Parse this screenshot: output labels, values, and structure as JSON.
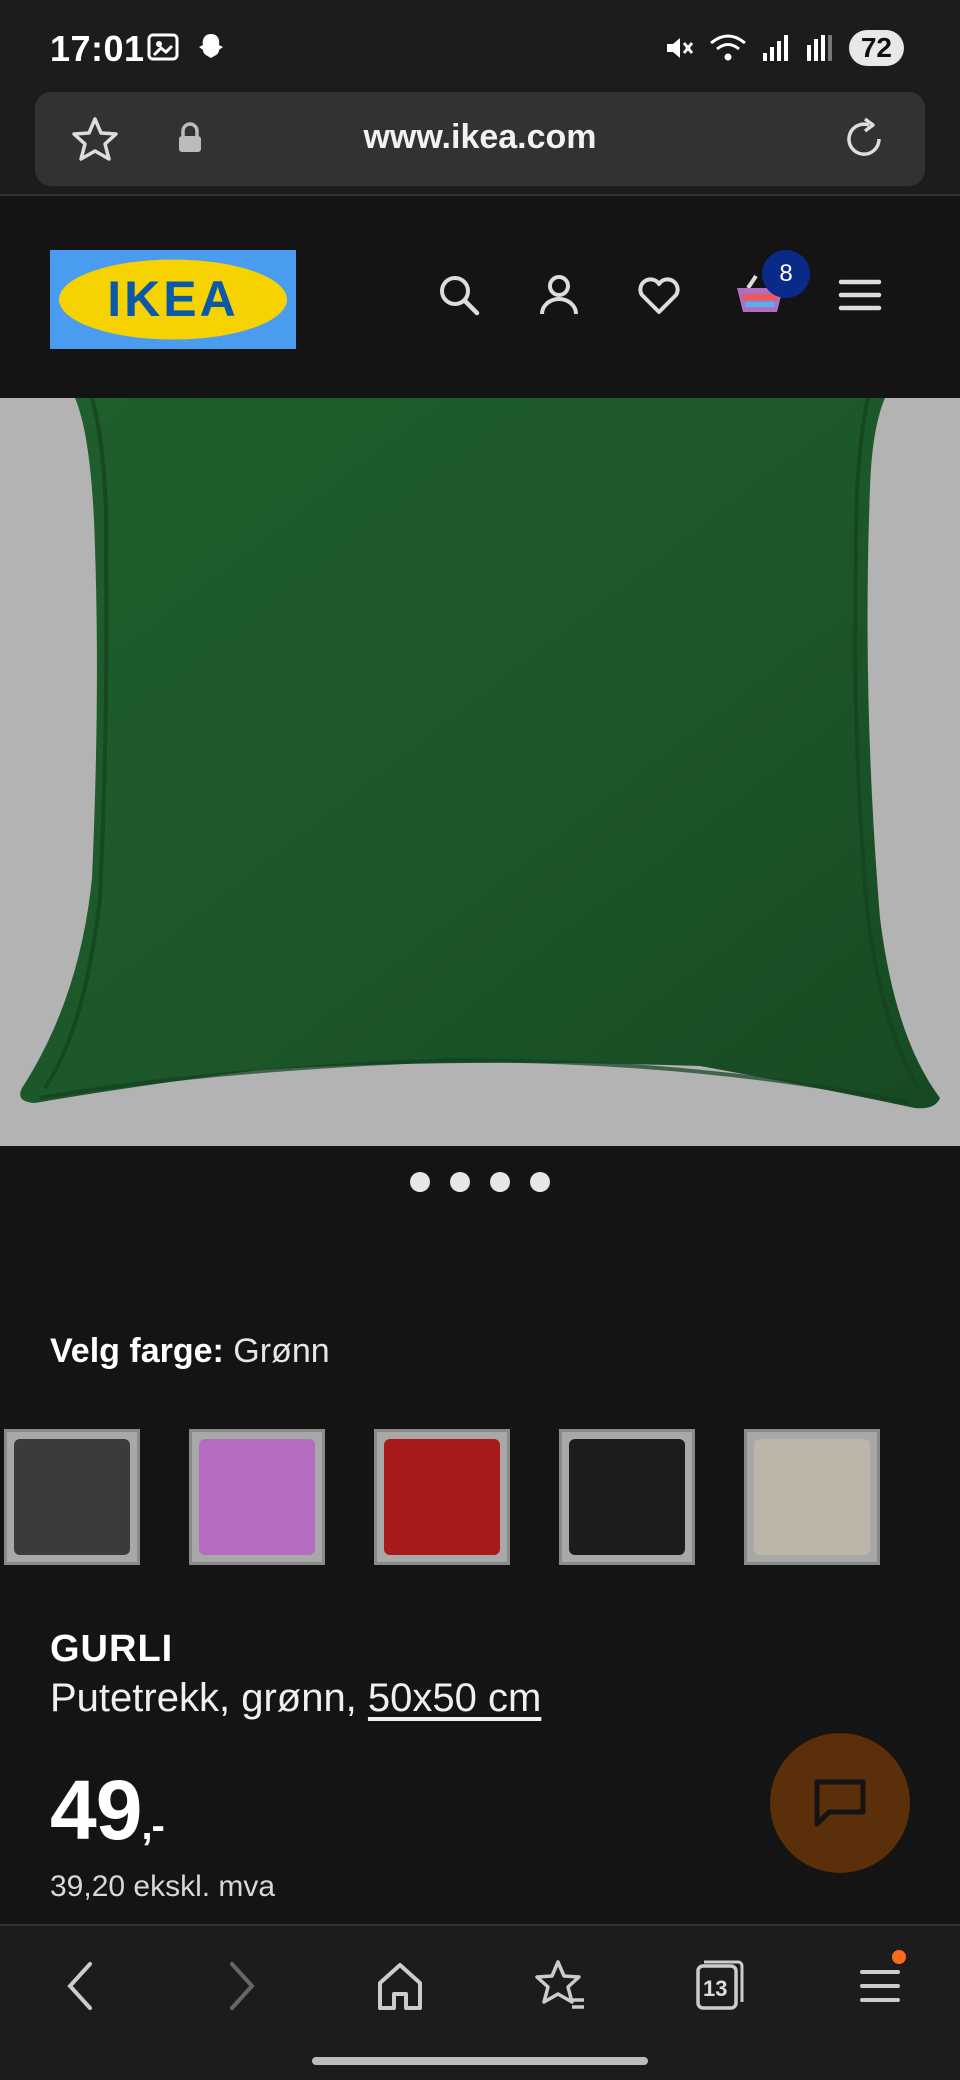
{
  "status_bar": {
    "time": "17:01",
    "battery": "72"
  },
  "browser": {
    "url": "www.ikea.com"
  },
  "header": {
    "logo_text": "IKEA",
    "cart_count": "8"
  },
  "gallery": {
    "dot_count": 4
  },
  "color_selector": {
    "label": "Velg farge:",
    "selected": "Grønn",
    "swatches": [
      {
        "name": "dark-grey",
        "color": "#3b3b3b"
      },
      {
        "name": "lilac",
        "color": "#b46cc0"
      },
      {
        "name": "red",
        "color": "#a81a1a"
      },
      {
        "name": "black",
        "color": "#1c1c1c"
      },
      {
        "name": "beige",
        "color": "#bcb5a8"
      }
    ]
  },
  "product": {
    "name": "GURLI",
    "description": "Putetrekk, grønn, ",
    "size": "50x50 cm",
    "price": "49",
    "price_suffix": ",-",
    "price_ex_vat": "39,20 ekskl. mva"
  },
  "bottom_bar": {
    "tab_count": "13"
  },
  "colors": {
    "product": "#1f5a2b",
    "accent_badge": "#0a2a8a",
    "chat": "#5a2f0a"
  }
}
